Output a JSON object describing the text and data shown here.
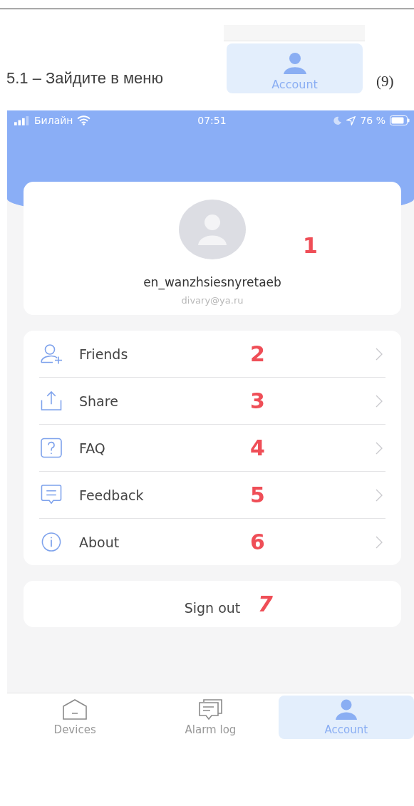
{
  "document": {
    "caption": "5.1 – Зайдите в меню",
    "inset_tab": {
      "label": "Account",
      "kind": "account"
    },
    "figure_number": "(9)"
  },
  "status_bar": {
    "carrier": "Билайн",
    "time": "07:51",
    "battery": "76 %"
  },
  "profile": {
    "username": "en_wanzhsiesnyretaeb",
    "email": "divary@ya.ru",
    "annotation": "1"
  },
  "menu": [
    {
      "label": "Friends",
      "kind": "friends",
      "annotation": "2"
    },
    {
      "label": "Share",
      "kind": "share",
      "annotation": "3"
    },
    {
      "label": "FAQ",
      "kind": "faq",
      "annotation": "4"
    },
    {
      "label": "Feedback",
      "kind": "feedback",
      "annotation": "5"
    },
    {
      "label": "About",
      "kind": "about",
      "annotation": "6"
    }
  ],
  "sign_out": {
    "label": "Sign out",
    "annotation": "7"
  },
  "tab_bar": [
    {
      "label": "Devices",
      "kind": "devices",
      "selected": false
    },
    {
      "label": "Alarm log",
      "kind": "alarms",
      "selected": false
    },
    {
      "label": "Account",
      "kind": "account",
      "selected": true
    }
  ]
}
